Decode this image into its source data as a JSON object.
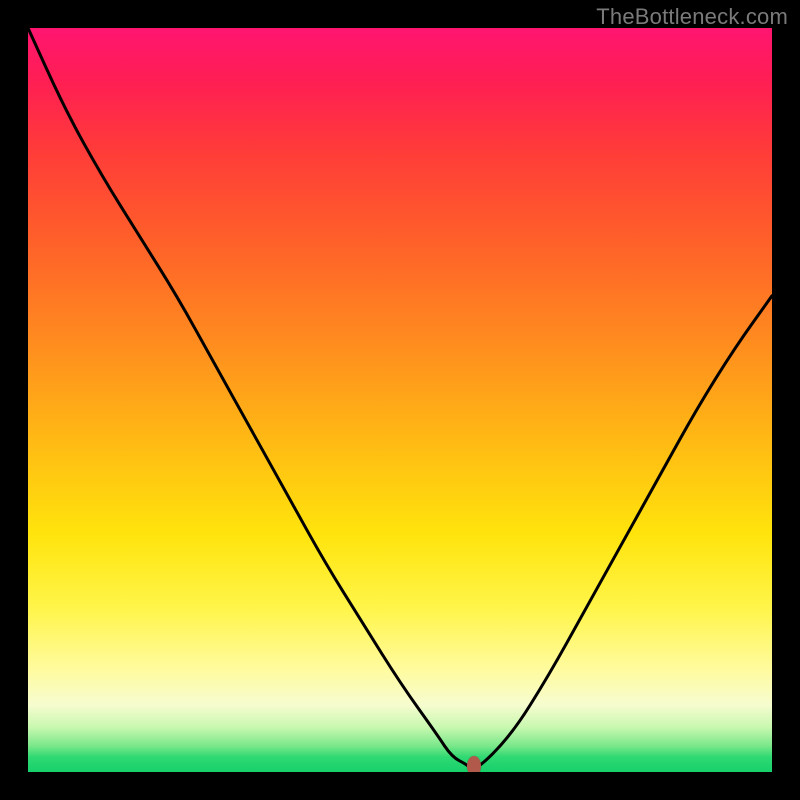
{
  "watermark": "TheBottleneck.com",
  "colors": {
    "frame": "#000000",
    "curve": "#000000",
    "marker": "#b15a4c",
    "gradient_stops": [
      "#ff1570",
      "#ff1e54",
      "#ff3a3a",
      "#ff5e2a",
      "#ff8b1f",
      "#ffb814",
      "#ffe40c",
      "#fff54a",
      "#fffb9c",
      "#f6fccf",
      "#c8f8b0",
      "#7ae88a",
      "#2fd973",
      "#17d06a"
    ]
  },
  "chart_data": {
    "type": "line",
    "title": "",
    "xlabel": "",
    "ylabel": "",
    "xlim": [
      0,
      100
    ],
    "ylim": [
      0,
      100
    ],
    "grid": false,
    "legend": false,
    "x": [
      0,
      5,
      10,
      15,
      20,
      25,
      30,
      35,
      40,
      45,
      50,
      55,
      57,
      59,
      60,
      65,
      70,
      75,
      80,
      85,
      90,
      95,
      100
    ],
    "y": [
      100,
      89,
      80,
      72,
      64,
      55,
      46,
      37,
      28,
      20,
      12,
      5,
      2,
      1,
      0,
      5,
      13,
      22,
      31,
      40,
      49,
      57,
      64
    ],
    "marker": {
      "x": 60,
      "y": 0
    },
    "note": "x and y in percent of plot area; y=100 top, y=0 bottom"
  }
}
